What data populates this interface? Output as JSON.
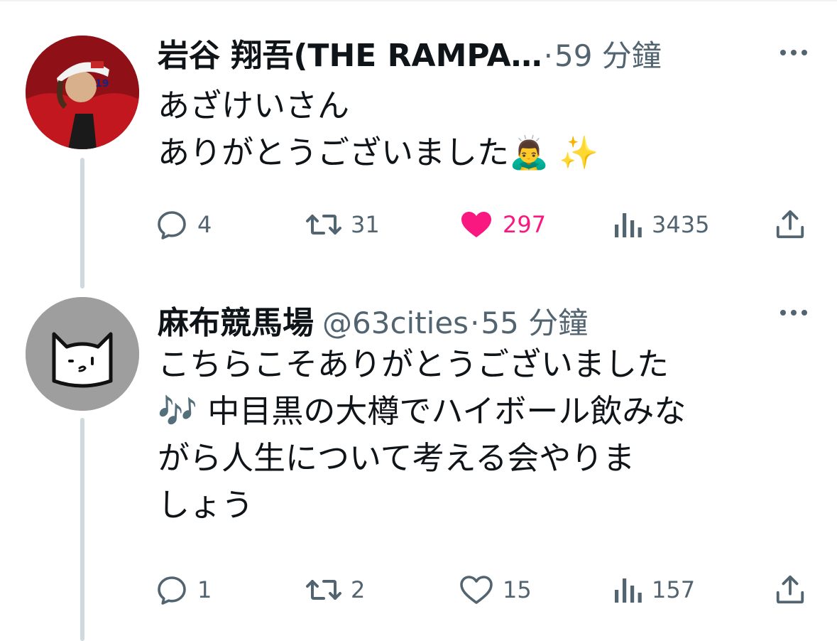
{
  "tweets": [
    {
      "author": {
        "display_name": "岩谷 翔吾(THE RAMPA…",
        "avatar": "photo-avatar"
      },
      "separator": "·",
      "time": "59 分鐘",
      "body_lines": [
        "あざけいさん",
        "ありがとうございました🙇‍♂️ ✨"
      ],
      "stats": {
        "replies": "4",
        "retweets": "31",
        "likes": "297",
        "views": "3435"
      },
      "liked": true
    },
    {
      "author": {
        "display_name": "麻布競馬場",
        "handle": "@63cities",
        "avatar": "cat-avatar"
      },
      "separator": "·",
      "time": "55 分鐘",
      "body_lines": [
        "こちらこそありがとうございました",
        "🎶 中目黒の大樽でハイボール飲みな",
        "がら人生について考える会やりま",
        "しょう"
      ],
      "stats": {
        "replies": "1",
        "retweets": "2",
        "likes": "15",
        "views": "157"
      },
      "liked": false
    }
  ],
  "icons": {
    "reply": "reply-icon",
    "retweet": "retweet-icon",
    "like": "heart-icon",
    "views": "views-icon",
    "share": "share-icon",
    "more": "more-icon"
  },
  "colors": {
    "text": "#0f1419",
    "secondary": "#536471",
    "like_active": "#f91880",
    "thread_line": "#cfd9de"
  }
}
